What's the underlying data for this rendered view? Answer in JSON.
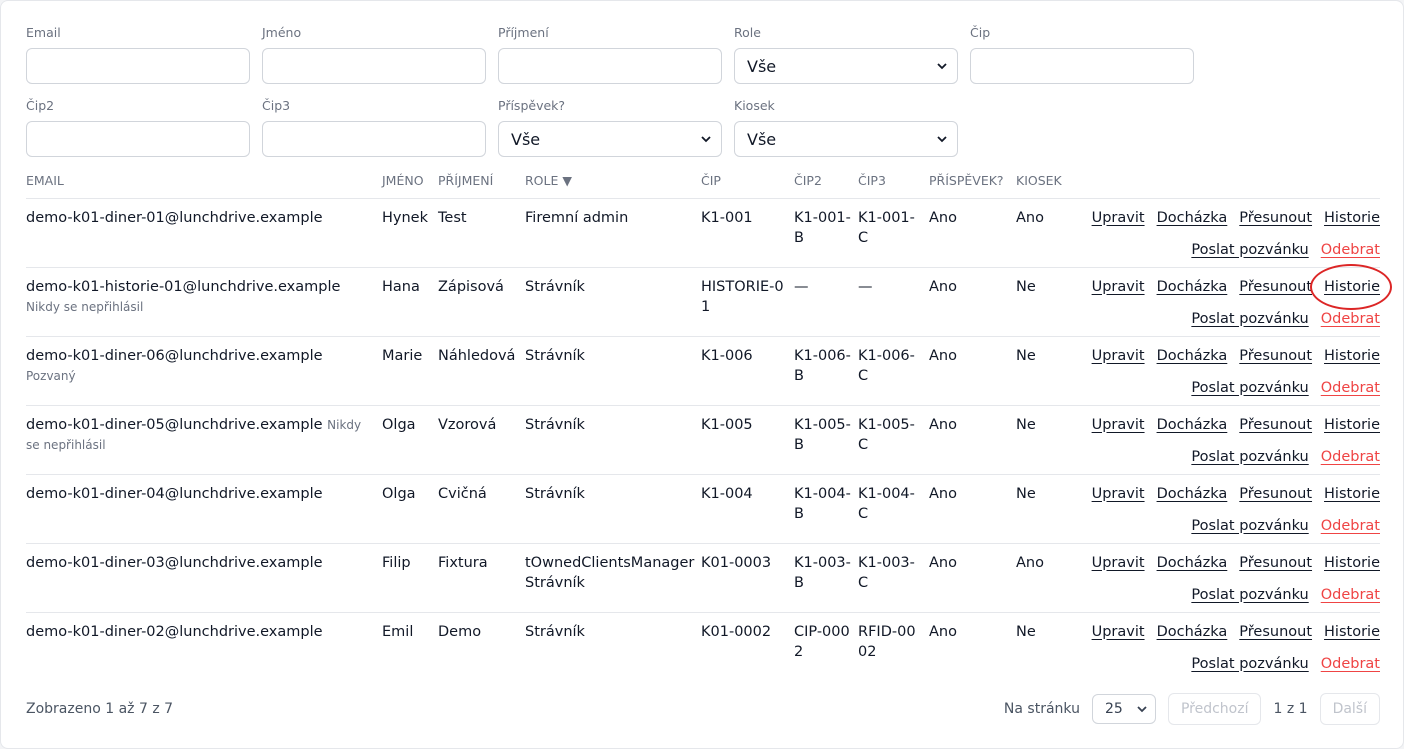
{
  "filters": {
    "row1": [
      {
        "label": "Email",
        "type": "input",
        "value": ""
      },
      {
        "label": "Jméno",
        "type": "input",
        "value": ""
      },
      {
        "label": "Příjmení",
        "type": "input",
        "value": ""
      },
      {
        "label": "Role",
        "type": "select",
        "value": "Vše"
      },
      {
        "label": "Čip",
        "type": "input",
        "value": ""
      }
    ],
    "row2": [
      {
        "label": "Čip2",
        "type": "input",
        "value": ""
      },
      {
        "label": "Čip3",
        "type": "input",
        "value": ""
      },
      {
        "label": "Příspěvek?",
        "type": "select",
        "value": "Vše"
      },
      {
        "label": "Kiosek",
        "type": "select",
        "value": "Vše"
      }
    ]
  },
  "table": {
    "headers": {
      "email": "EMAIL",
      "jmeno": "JMÉNO",
      "prijmeni": "PŘÍJMENÍ",
      "role": "ROLE ▼",
      "cip": "ČIP",
      "cip2": "ČIP2",
      "cip3": "ČIP3",
      "prispevek": "PŘÍSPĚVEK?",
      "kiosek": "KIOSEK"
    },
    "actions": {
      "edit": "Upravit",
      "attendance": "Docházka",
      "move": "Přesunout",
      "history": "Historie",
      "invite": "Poslat pozvánku",
      "remove": "Odebrat"
    },
    "rows": [
      {
        "email": "demo-k01-diner-01@lunchdrive.example",
        "note": "",
        "jmeno": "Hynek",
        "prijmeni": "Test",
        "role": "Firemní admin",
        "cip": "K1-001",
        "cip2": "K1-001-B",
        "cip3": "K1-001-C",
        "prispevek": "Ano",
        "kiosek": "Ano"
      },
      {
        "email": "demo-k01-historie-01@lunchdrive.example",
        "note": "Nikdy se nepřihlásil",
        "jmeno": "Hana",
        "prijmeni": "Zápisová",
        "role": "Strávník",
        "cip": "HISTORIE-01",
        "cip2": "—",
        "cip3": "—",
        "prispevek": "Ano",
        "kiosek": "Ne"
      },
      {
        "email": "demo-k01-diner-06@lunchdrive.example",
        "note": "Pozvaný",
        "jmeno": "Marie",
        "prijmeni": "Náhledová",
        "role": "Strávník",
        "cip": "K1-006",
        "cip2": "K1-006-B",
        "cip3": "K1-006-C",
        "prispevek": "Ano",
        "kiosek": "Ne"
      },
      {
        "email": "demo-k01-diner-05@lunchdrive.example",
        "note": "Nikdy se nepřihlásil",
        "jmeno": "Olga",
        "prijmeni": "Vzorová",
        "role": "Strávník",
        "cip": "K1-005",
        "cip2": "K1-005-B",
        "cip3": "K1-005-C",
        "prispevek": "Ano",
        "kiosek": "Ne"
      },
      {
        "email": "demo-k01-diner-04@lunchdrive.example",
        "note": "",
        "jmeno": "Olga",
        "prijmeni": "Cvičná",
        "role": "Strávník",
        "cip": "K1-004",
        "cip2": "K1-004-B",
        "cip3": "K1-004-C",
        "prispevek": "Ano",
        "kiosek": "Ne"
      },
      {
        "email": "demo-k01-diner-03@lunchdrive.example",
        "note": "",
        "jmeno": "Filip",
        "prijmeni": "Fixtura",
        "role": "tOwnedClientsManager Strávník",
        "cip": "K01-0003",
        "cip2": "K1-003-B",
        "cip3": "K1-003-C",
        "prispevek": "Ano",
        "kiosek": "Ano"
      },
      {
        "email": "demo-k01-diner-02@lunchdrive.example",
        "note": "",
        "jmeno": "Emil",
        "prijmeni": "Demo",
        "role": "Strávník",
        "cip": "K01-0002",
        "cip2": "CIP-0002",
        "cip3": "RFID-0002",
        "prispevek": "Ano",
        "kiosek": "Ne"
      }
    ]
  },
  "footer": {
    "summary": "Zobrazeno 1 až 7 z 7",
    "per_page_label": "Na stránku",
    "per_page_value": "25",
    "prev": "Předchozí",
    "page_info": "1 z 1",
    "next": "Další"
  },
  "colors": {
    "danger": "#ef4444",
    "highlight_circle": "#dc2626"
  }
}
